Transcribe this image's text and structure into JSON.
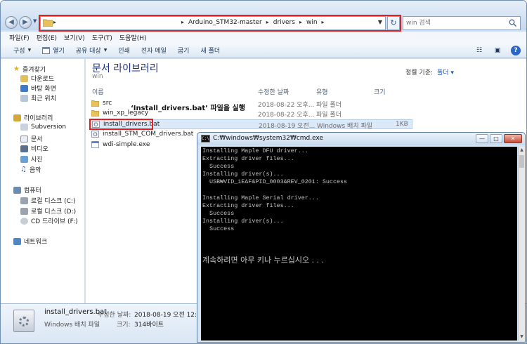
{
  "explorer": {
    "breadcrumbs": [
      "Arduino_STM32-master",
      "drivers",
      "win"
    ],
    "search_placeholder": "win 검색",
    "menu": [
      "파일(F)",
      "편집(E)",
      "보기(V)",
      "도구(T)",
      "도움말(H)"
    ],
    "toolbar": [
      "구성",
      "열기",
      "공유 대상",
      "인쇄",
      "전자 메일",
      "굽기",
      "새 폴더"
    ],
    "sidebar": {
      "favorites": {
        "header": "즐겨찾기",
        "items": [
          "다운로드",
          "바탕 화면",
          "최근 위치"
        ]
      },
      "libraries": {
        "header": "라이브러리",
        "items": [
          "Subversion",
          "문서",
          "비디오",
          "사진",
          "음악"
        ]
      },
      "computer": {
        "header": "컴퓨터",
        "items": [
          "로컬 디스크 (C:)",
          "로컬 디스크 (D:)",
          "CD 드라이브 (F:)"
        ]
      },
      "network": "네트워크"
    },
    "library_title": "문서 라이브러리",
    "library_subtitle": "win",
    "sort_label": "정렬 기준:",
    "sort_value": "폴더 ▾",
    "columns": {
      "name": "이름",
      "modified": "수정한 날짜",
      "type": "유형",
      "size": "크기"
    },
    "files": [
      {
        "name": "src",
        "modified": "2018-08-22 오후...",
        "type": "파일 폴더",
        "size": "",
        "kind": "folder"
      },
      {
        "name": "win_xp_legacy",
        "modified": "2018-08-22 오후...",
        "type": "파일 폴더",
        "size": "",
        "kind": "folder"
      },
      {
        "name": "install_drivers.bat",
        "modified": "2018-08-19 오전...",
        "type": "Windows 배치 파일",
        "size": "1KB",
        "kind": "bat"
      },
      {
        "name": "install_STM_COM_drivers.bat",
        "modified": "",
        "type": "",
        "size": "",
        "kind": "bat"
      },
      {
        "name": "wdi-simple.exe",
        "modified": "",
        "type": "",
        "size": "",
        "kind": "exe"
      }
    ],
    "annotation": "‘Install_drivers.bat’ 파일을 실행",
    "details": {
      "name": "install_drivers.bat",
      "type": "Windows 배치 파일",
      "modified_label": "수정한 날짜:",
      "modified_value": "2018-08-19 오전 12:23",
      "size_label": "크기:",
      "size_value": "314바이트"
    }
  },
  "cmd": {
    "title": "C:₩windows₩system32₩cmd.exe",
    "icon_text": "C:\\",
    "lines": [
      "Installing Maple DFU driver...",
      "Extracting driver files...",
      "  Success",
      "Installing driver(s)...",
      "  USB₩VID_1EAF&PID_0003&REV_0201: Success",
      "",
      "Installing Maple Serial driver...",
      "Extracting driver files...",
      "  Success",
      "Installing driver(s)...",
      "  Success"
    ],
    "prompt": "계속하려면 아무 키나 누르십시오 . . ."
  }
}
